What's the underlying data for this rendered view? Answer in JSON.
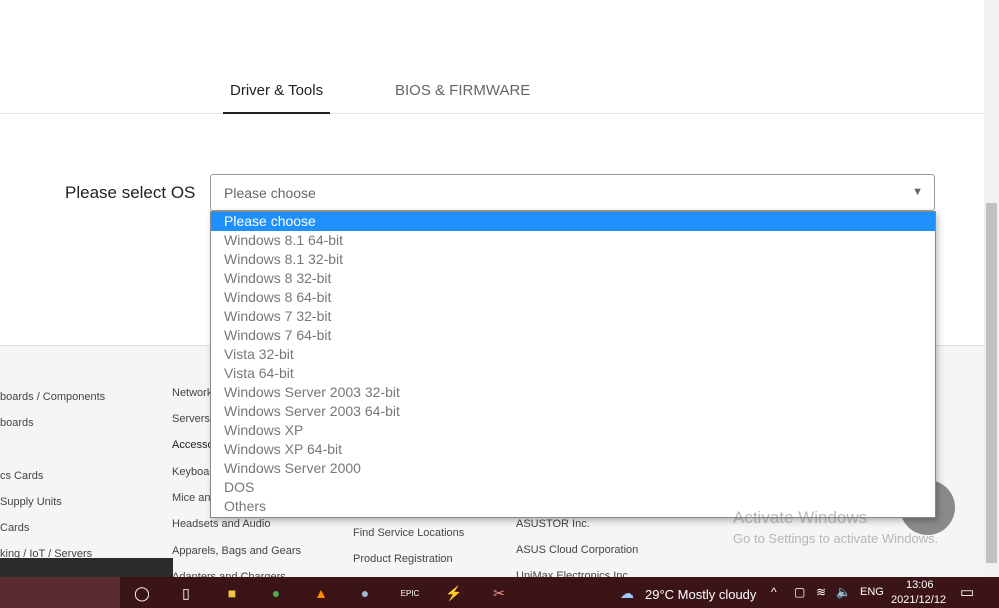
{
  "tabs": [
    {
      "label": "Driver & Tools",
      "active": true
    },
    {
      "label": "BIOS & FIRMWARE",
      "active": false
    }
  ],
  "os_select": {
    "label": "Please select OS",
    "value": "Please choose",
    "options": [
      "Please choose",
      "Windows 8.1 64-bit",
      "Windows 8.1 32-bit",
      "Windows 8 32-bit",
      "Windows 8 64-bit",
      "Windows 7 32-bit",
      "Windows 7 64-bit",
      "Vista 32-bit",
      "Vista 64-bit",
      "Windows Server 2003 32-bit",
      "Windows Server 2003 64-bit",
      "Windows XP",
      "Windows XP 64-bit",
      "Windows Server 2000",
      "DOS",
      "Others"
    ]
  },
  "footer": {
    "col1": [
      "boards / Components",
      "boards",
      "",
      "cs Cards",
      "Supply Units",
      "Cards",
      "king / IoT / Servers"
    ],
    "col2": [
      "Network",
      "Servers",
      "Accesso",
      "Keyboar",
      "Mice an",
      "Headsets and Audio",
      "Apparels, Bags and Gears",
      "Adapters and Chargers"
    ],
    "col3": [
      "Find Service Locations",
      "Product Registration"
    ],
    "col4": [
      "ASUSTOR Inc.",
      "ASUS Cloud Corporation",
      "UniMax Electronics Inc."
    ]
  },
  "watermark": {
    "title": "Activate Windows",
    "subtitle": "Go to Settings to activate Windows."
  },
  "taskbar": {
    "weather": "29°C  Mostly cloudy",
    "language": "ENG",
    "time": "13:06",
    "date": "2021/12/12"
  },
  "colors": {
    "selected": "#1e90ff",
    "taskbar": "#3b1418"
  }
}
